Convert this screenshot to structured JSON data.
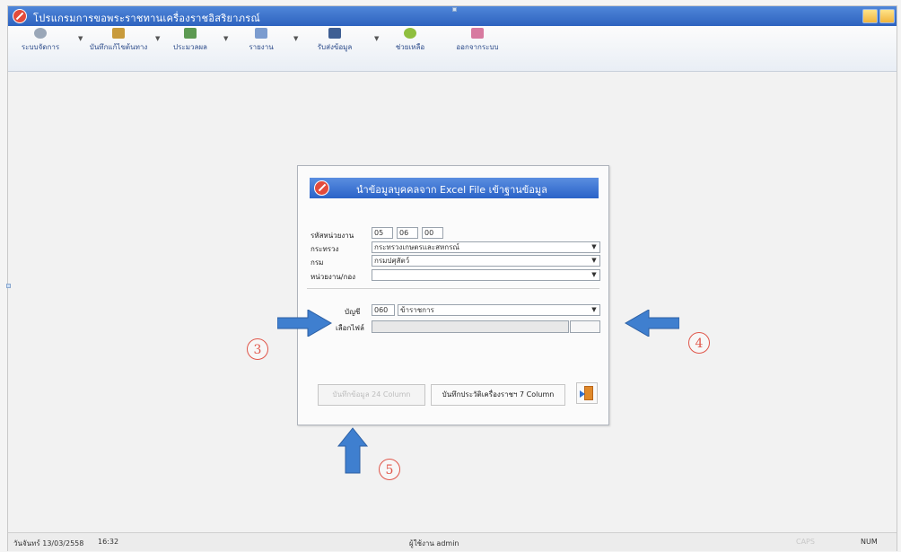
{
  "window": {
    "title": "โปรแกรมการขอพระราชทานเครื่องราชอิสริยาภรณ์"
  },
  "toolbar": {
    "items": [
      {
        "label": "ระบบจัดการ",
        "icon": "key-icon",
        "has_dropdown": true
      },
      {
        "label": "บันทึกแก้ไขต้นทาง",
        "icon": "edit-icon",
        "has_dropdown": true
      },
      {
        "label": "ประมวลผล",
        "icon": "process-icon",
        "has_dropdown": true
      },
      {
        "label": "รายงาน",
        "icon": "report-icon",
        "has_dropdown": true
      },
      {
        "label": "รับส่งข้อมูล",
        "icon": "save-icon",
        "has_dropdown": true
      },
      {
        "label": "ช่วยเหลือ",
        "icon": "help-icon",
        "has_dropdown": false
      },
      {
        "label": "ออกจากระบบ",
        "icon": "logout-icon",
        "has_dropdown": false
      }
    ]
  },
  "dialog": {
    "title": "นำข้อมูลบุคคลจาก Excel File เข้าฐานข้อมูล",
    "unit_code_label": "รหัสหน่วยงาน",
    "unit_code": [
      "05",
      "06",
      "00"
    ],
    "ministry_label": "กระทรวง",
    "ministry_value": "กระทรวงเกษตรและสหกรณ์",
    "department_label": "กรม",
    "department_value": "กรมปศุสัตว์",
    "division_label": "หน่วยงาน/กอง",
    "division_value": "",
    "account_label": "บัญชี",
    "account_code": "060",
    "account_value": "ข้าราชการ",
    "file_label": "เลือกไฟล์",
    "file_value": "",
    "button_save_24": "บันทึกข้อมูล 24 Column",
    "button_save_7": "บันทึกประวัติเครื่องราชฯ 7 Column"
  },
  "annotations": [
    "3",
    "4",
    "5"
  ],
  "colors": {
    "arrow": "#3f7fcf",
    "badge": "#e0564a",
    "title_bar": "#2e63bf"
  },
  "statusbar": {
    "date": "วันจันทร์ 13/03/2558",
    "time": "16:32",
    "user": "ผู้ใช้งาน admin",
    "caps": "CAPS",
    "num": "NUM"
  }
}
